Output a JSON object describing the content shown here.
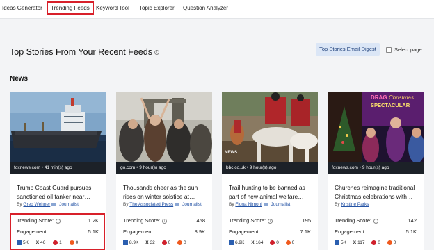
{
  "nav": {
    "tabs": [
      {
        "label": "Ideas Generator"
      },
      {
        "label": "Trending Feeds"
      },
      {
        "label": "Keyword Tool"
      },
      {
        "label": "Topic Explorer"
      },
      {
        "label": "Question Analyzer"
      }
    ],
    "active_tab": "Trending Feeds"
  },
  "header": {
    "title": "Top Stories From Your Recent Feeds",
    "email_button": "Top Stories Email Digest",
    "select_page": "Select page"
  },
  "section": {
    "title": "News"
  },
  "cards": [
    {
      "source": "foxnews.com • 41 min(s) ago",
      "title": "Trump Coast Guard pursues sanctioned oil tanker near…",
      "by": "By",
      "author": "Greg Wehner",
      "role": "Journalist",
      "trending_label": "Trending Score:",
      "trending": "1.2K",
      "engagement_label": "Engagement:",
      "engagement": "5.1K",
      "facebook": "5K",
      "x": "46",
      "pinterest": "1",
      "reddit": "0"
    },
    {
      "source": "go.com • 9 hour(s) ago",
      "title": "Thousands cheer as the sun rises on winter solstice at…",
      "by": "By",
      "author": "The Associated Press",
      "role": "Journalist",
      "trending_label": "Trending Score:",
      "trending": "458",
      "engagement_label": "Engagement:",
      "engagement": "8.9K",
      "facebook": "8.9K",
      "x": "32",
      "pinterest": "0",
      "reddit": "0"
    },
    {
      "source": "bbc.co.uk • 9 hour(s) ago",
      "title": "Trail hunting to be banned as part of new animal welfare…",
      "by": "By",
      "author": "Fiona Nimoni",
      "role": "Journalist",
      "trending_label": "Trending Score:",
      "trending": "195",
      "engagement_label": "Engagement:",
      "engagement": "7.1K",
      "facebook": "6.9K",
      "x": "164",
      "pinterest": "0",
      "reddit": "0"
    },
    {
      "source": "foxnews.com • 9 hour(s) ago",
      "title": "Churches reimagine traditional Christmas celebrations with…",
      "by": "By",
      "author": "Kristine Parks",
      "role": "",
      "trending_label": "Trending Score:",
      "trending": "142",
      "engagement_label": "Engagement:",
      "engagement": "5.1K",
      "facebook": "5K",
      "x": "117",
      "pinterest": "0",
      "reddit": "0"
    }
  ],
  "image_texts": {
    "bbc_watermark": "NEWS",
    "drag_banner": "DRAG",
    "christmas_banner": "Christmas",
    "spectacular_banner": "SPECTACULAR"
  }
}
